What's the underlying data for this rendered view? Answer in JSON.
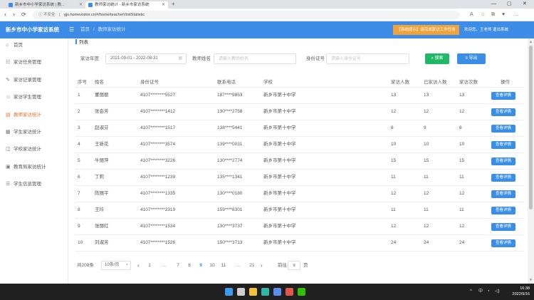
{
  "browser": {
    "tabs": [
      {
        "title": "新乡市中小学家访系统 | 教..."
      },
      {
        "title": "教师家访统计 - 新乡市家访系统"
      }
    ],
    "new_tab": "+",
    "window_controls": {
      "minimize": "—",
      "maximize": "▢",
      "close": "✕"
    },
    "nav": {
      "back": "‹",
      "forward": "›",
      "reload": "⟳"
    },
    "security": "ⓘ 不安全",
    "separator": "|",
    "url": "gjs.homevisitor.cn/#/home/teacherVisitStatistic",
    "toolbar_icons": [
      "A",
      "☆",
      "⧉",
      "♥",
      "…"
    ]
  },
  "app": {
    "title": "新乡市中小学家访系统",
    "menu_glyph": "☰",
    "breadcrumb_home": "首页",
    "breadcrumb_sep": "/",
    "breadcrumb_current": "教师家访统计",
    "notice": "【系统提示】请完成家访工作任务",
    "user": "欢迎您，王老师 退出系统"
  },
  "sidebar": {
    "active_index": 4,
    "items": [
      {
        "label": "首页",
        "glyph": "⌂",
        "icon": "home-icon"
      },
      {
        "label": "家访任务管理",
        "glyph": "☷",
        "icon": "task-list-icon"
      },
      {
        "label": "家访记录管理",
        "glyph": "✎",
        "icon": "edit-record-icon"
      },
      {
        "label": "家访学生管理",
        "glyph": "☺",
        "icon": "student-icon"
      },
      {
        "label": "教师家访统计",
        "glyph": "▤",
        "icon": "statistics-icon"
      },
      {
        "label": "学生家访统计",
        "glyph": "▦",
        "icon": "chart-grid-icon"
      },
      {
        "label": "学校家访统计",
        "glyph": "◫",
        "icon": "school-icon"
      },
      {
        "label": "教育局家访统计",
        "glyph": "▣",
        "icon": "bureau-icon"
      },
      {
        "label": "学生信息管理",
        "glyph": "☰",
        "icon": "info-list-icon"
      }
    ]
  },
  "section_title": "列表",
  "filters": {
    "year_label": "家访年度",
    "year_value": "2021-09-01 - 2022-08-31",
    "calendar_glyph": "▦",
    "teacher_label": "教师姓名",
    "teacher_placeholder": "请输入教师姓名",
    "id_label": "身份证号",
    "id_placeholder": "请输入身份证号",
    "search_label": "⌕ 搜索",
    "export_label": "≡ 导出"
  },
  "table": {
    "headers": {
      "index": "序号",
      "name": "姓名",
      "id_card": "身份证号",
      "phone": "联系电话",
      "school": "学校",
      "visit_count": "家访人数",
      "visited_count": "已家访人数",
      "visit_times": "家访次数",
      "op": "操作"
    },
    "action_label": "查看详情",
    "rows": [
      {
        "index": "1",
        "name": "董丽丽",
        "id_card": "4107********5527",
        "phone": "187****9853",
        "school": "新乡市第十中学",
        "visit_count": "13",
        "visited_count": "13",
        "visit_times": "13"
      },
      {
        "index": "2",
        "name": "张会芳",
        "id_card": "4107********1412",
        "phone": "130****2758",
        "school": "新乡市第十中学",
        "visit_count": "12",
        "visited_count": "12",
        "visit_times": "12"
      },
      {
        "index": "3",
        "name": "赵淑芬",
        "id_card": "4107********1517",
        "phone": "138****5441",
        "school": "新乡市第十中学",
        "visit_count": "8",
        "visited_count": "9",
        "visit_times": "8"
      },
      {
        "index": "4",
        "name": "王新花",
        "id_card": "4107********3574",
        "phone": "139****0031",
        "school": "新乡市第十中学",
        "visit_count": "10",
        "visited_count": "10",
        "visit_times": "10"
      },
      {
        "index": "5",
        "name": "牛丽萍",
        "id_card": "4107********3226",
        "phone": "130****2774",
        "school": "新乡市第十中学",
        "visit_count": "15",
        "visited_count": "15",
        "visit_times": "15"
      },
      {
        "index": "6",
        "name": "丁莉",
        "id_card": "4107********1239",
        "phone": "135****1341",
        "school": "新乡市第十中学",
        "visit_count": "11",
        "visited_count": "11",
        "visit_times": "11"
      },
      {
        "index": "7",
        "name": "陈丽平",
        "id_card": "4107********1335",
        "phone": "130****0180",
        "school": "新乡市第十中学",
        "visit_count": "12",
        "visited_count": "12",
        "visit_times": "12"
      },
      {
        "index": "8",
        "name": "王玲",
        "id_card": "4107********2319",
        "phone": "159****8301",
        "school": "新乡市第十中学",
        "visit_count": "11",
        "visited_count": "11",
        "visit_times": "11"
      },
      {
        "index": "9",
        "name": "张丽红",
        "id_card": "4107********1534",
        "phone": "130****3737",
        "school": "新乡市第十中学",
        "visit_count": "12",
        "visited_count": "12",
        "visit_times": "12"
      },
      {
        "index": "10",
        "name": "刘淑芳",
        "id_card": "4107********1526",
        "phone": "150****3713",
        "school": "新乡市第十中学",
        "visit_count": "24",
        "visited_count": "24",
        "visit_times": "24"
      }
    ]
  },
  "pagination": {
    "total": "共208条",
    "page_size": "10条/页",
    "caret": "▾",
    "prev": "‹",
    "next": "›",
    "pages": [
      "1",
      "…",
      "7",
      "8",
      "9",
      "10",
      "11",
      "…",
      "21"
    ],
    "current": "9",
    "goto_label": "前往",
    "goto_value": "9",
    "goto_suffix": "页"
  },
  "scrollbar": {
    "up": "▲",
    "down": "▼"
  },
  "taskbar": {
    "apps": [
      {
        "icon": "windows-start-icon",
        "color": "#3a9bf0"
      },
      {
        "icon": "search-icon",
        "color": "#cfcfcf"
      },
      {
        "icon": "file-explorer-icon",
        "color": "#f3c13a"
      },
      {
        "icon": "edge-browser-icon",
        "color": "#2fb8a6"
      },
      {
        "icon": "store-icon",
        "color": "#5b8def"
      },
      {
        "icon": "chrome-browser-icon",
        "color": "#e2574c"
      },
      {
        "icon": "wechat-icon",
        "color": "#2dc100"
      }
    ],
    "tray_chevron": "^",
    "ime": "中",
    "network": "◔",
    "volume": "◁)",
    "time": "16:38",
    "date": "2022/9/16"
  },
  "colors": {
    "header": "#3d8ce8",
    "accent": "#e6702e",
    "search_button": "#1fb866",
    "export_button": "#3a8ee6",
    "detail_button": "#3a8ee6",
    "notice": "#f0a33c",
    "taskbar": "#202020"
  }
}
